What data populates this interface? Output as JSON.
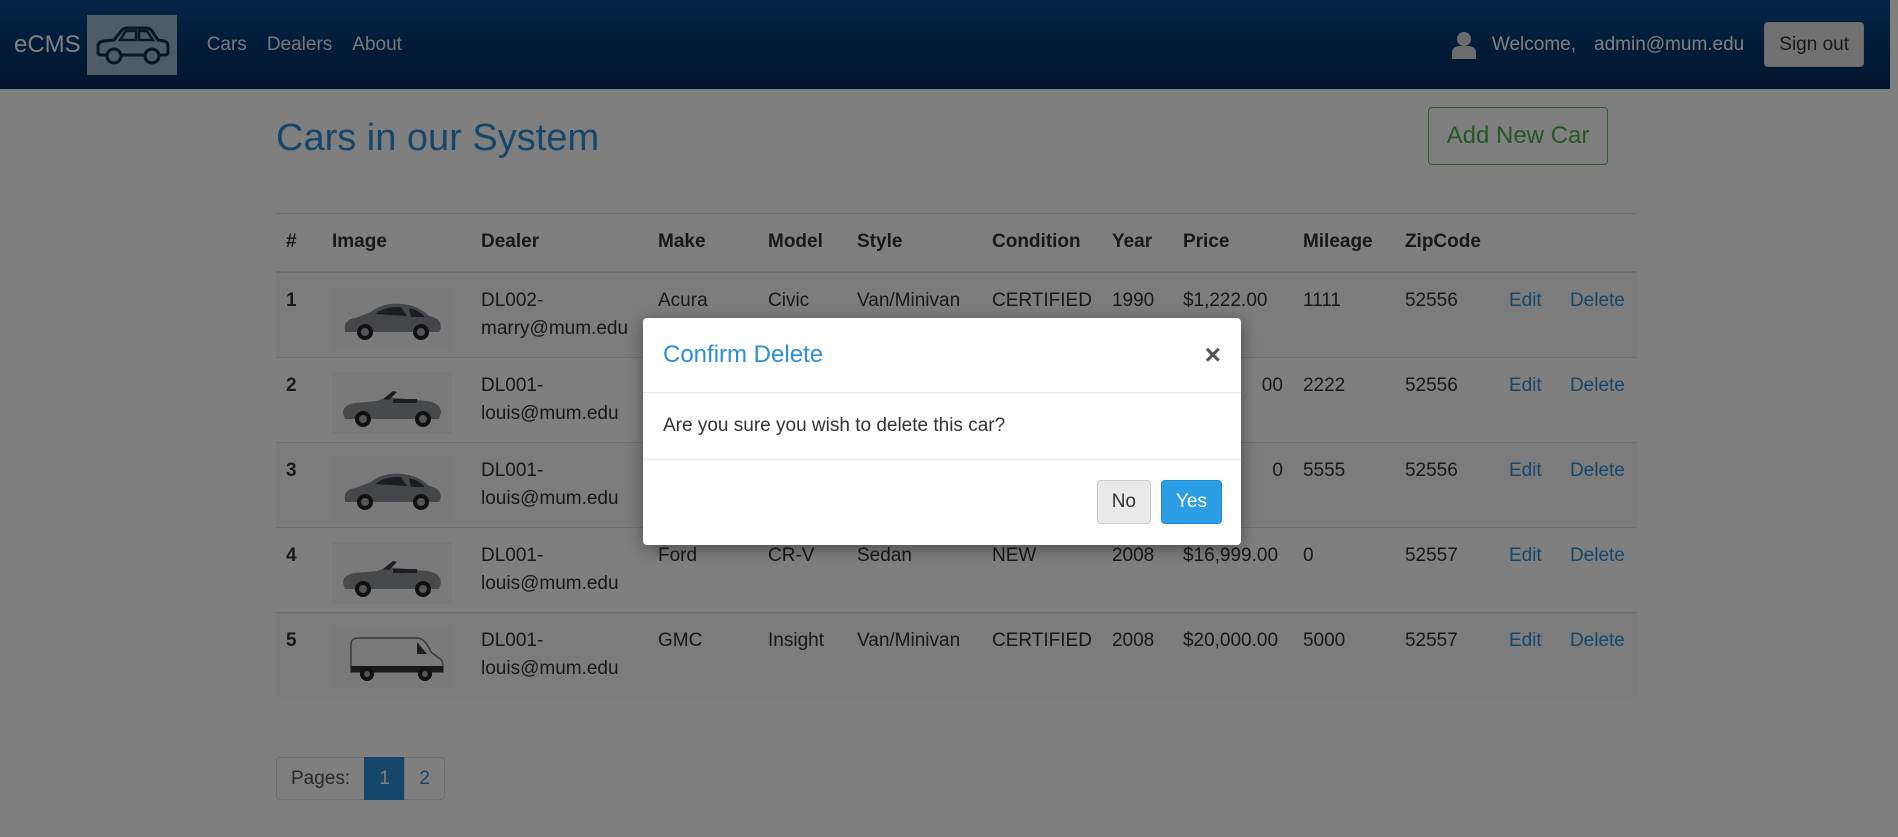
{
  "navbar": {
    "brand": "eCMS",
    "links": [
      "Cars",
      "Dealers",
      "About"
    ],
    "welcome": "Welcome,",
    "user_email": "admin@mum.edu",
    "signout": "Sign out"
  },
  "page": {
    "title": "Cars in our System",
    "add_button": "Add New Car"
  },
  "table": {
    "headers": [
      "#",
      "Image",
      "Dealer",
      "Make",
      "Model",
      "Style",
      "Condition",
      "Year",
      "Price",
      "Mileage",
      "ZipCode"
    ],
    "rows": [
      {
        "num": "1",
        "image": "sedan-car-icon",
        "dealer_1": "DL002-",
        "dealer_2": "marry@mum.edu",
        "make": "Acura",
        "model": "Civic",
        "style": "Van/Minivan",
        "condition": "CERTIFIED",
        "year": "1990",
        "price": "$1,222.00",
        "mileage": "1111",
        "zip": "52556",
        "edit": "Edit",
        "delete": "Delete"
      },
      {
        "num": "2",
        "image": "convertible-car-icon",
        "dealer_1": "DL001-",
        "dealer_2": "louis@mum.edu",
        "make": "",
        "model": "",
        "style": "",
        "condition": "",
        "year": "",
        "price": "00",
        "mileage": "2222",
        "zip": "52556",
        "edit": "Edit",
        "delete": "Delete"
      },
      {
        "num": "3",
        "image": "sedan-car-icon",
        "dealer_1": "DL001-",
        "dealer_2": "louis@mum.edu",
        "make": "",
        "model": "",
        "style": "",
        "condition": "",
        "year": "",
        "price": "0",
        "mileage": "5555",
        "zip": "52556",
        "edit": "Edit",
        "delete": "Delete"
      },
      {
        "num": "4",
        "image": "convertible-car-icon",
        "dealer_1": "DL001-",
        "dealer_2": "louis@mum.edu",
        "make": "Ford",
        "model": "CR-V",
        "style": "Sedan",
        "condition": "NEW",
        "year": "2008",
        "price": "$16,999.00",
        "mileage": "0",
        "zip": "52557",
        "edit": "Edit",
        "delete": "Delete"
      },
      {
        "num": "5",
        "image": "van-icon",
        "dealer_1": "DL001-",
        "dealer_2": "louis@mum.edu",
        "make": "GMC",
        "model": "Insight",
        "style": "Van/Minivan",
        "condition": "CERTIFIED",
        "year": "2008",
        "price": "$20,000.00",
        "mileage": "5000",
        "zip": "52557",
        "edit": "Edit",
        "delete": "Delete"
      }
    ]
  },
  "pagination": {
    "label": "Pages:",
    "pages": [
      "1",
      "2"
    ],
    "active": "1"
  },
  "modal": {
    "title": "Confirm Delete",
    "close": "×",
    "message": "Are you sure you wish to delete this car?",
    "no": "No",
    "yes": "Yes"
  },
  "colors": {
    "navbar": "#03376f",
    "accent": "#2c8ed6",
    "add_button": "#5cb85c",
    "yes_button": "#2c9ee6"
  }
}
